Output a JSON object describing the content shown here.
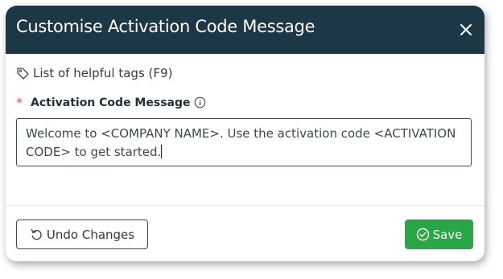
{
  "dialog": {
    "title": "Customise Activation Code Message",
    "close_icon": "close-icon"
  },
  "tags_link": {
    "icon": "tag-icon",
    "label": "List of helpful tags (F9)"
  },
  "field": {
    "required_marker": "*",
    "label": "Activation Code Message",
    "info_icon": "info-icon",
    "value": "Welcome to <COMPANY NAME>.  Use the activation code <ACTIVATION CODE> to get started."
  },
  "footer": {
    "undo_icon": "undo-icon",
    "undo_label": "Undo Changes",
    "save_icon": "check-circle-icon",
    "save_label": "Save"
  },
  "colors": {
    "header_bg": "#1c3745",
    "save_bg": "#28a745",
    "required": "#d9534f"
  }
}
